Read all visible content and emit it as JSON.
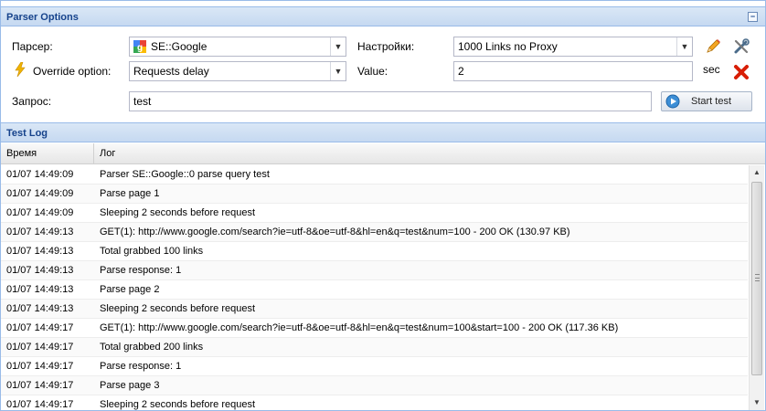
{
  "parser_options": {
    "title": "Parser Options",
    "parser_label": "Парсер:",
    "parser_value": "SE::Google",
    "settings_label": "Настройки:",
    "settings_value": "1000 Links no Proxy",
    "override_label": "Override option:",
    "override_value": "Requests delay",
    "value_label": "Value:",
    "value_value": "2",
    "value_unit": "sec",
    "query_label": "Запрос:",
    "query_value": "test",
    "start_test_label": "Start test",
    "icons": {
      "parser": "google-icon",
      "override": "lightning-icon",
      "edit": "pencil-icon",
      "tools": "tools-icon",
      "delete": "delete-x-icon",
      "start": "play-icon"
    }
  },
  "test_log": {
    "title": "Test Log",
    "columns": [
      "Время",
      "Лог"
    ],
    "rows": [
      {
        "time": "01/07 14:49:09",
        "log": "Parser SE::Google::0 parse query test"
      },
      {
        "time": "01/07 14:49:09",
        "log": "Parse page 1"
      },
      {
        "time": "01/07 14:49:09",
        "log": "Sleeping 2 seconds before request"
      },
      {
        "time": "01/07 14:49:13",
        "log": "GET(1): http://www.google.com/search?ie=utf-8&oe=utf-8&hl=en&q=test&num=100 - 200 OK (130.97 KB)"
      },
      {
        "time": "01/07 14:49:13",
        "log": "Total grabbed 100 links"
      },
      {
        "time": "01/07 14:49:13",
        "log": "Parse response: 1"
      },
      {
        "time": "01/07 14:49:13",
        "log": "Parse page 2"
      },
      {
        "time": "01/07 14:49:13",
        "log": "Sleeping 2 seconds before request"
      },
      {
        "time": "01/07 14:49:17",
        "log": "GET(1): http://www.google.com/search?ie=utf-8&oe=utf-8&hl=en&q=test&num=100&start=100 - 200 OK (117.36 KB)"
      },
      {
        "time": "01/07 14:49:17",
        "log": "Total grabbed 200 links"
      },
      {
        "time": "01/07 14:49:17",
        "log": "Parse response: 1"
      },
      {
        "time": "01/07 14:49:17",
        "log": "Parse page 3"
      },
      {
        "time": "01/07 14:49:17",
        "log": "Sleeping 2 seconds before request"
      }
    ]
  },
  "colors": {
    "header_text": "#15428b",
    "header_bg": "#c6d9f1",
    "border": "#99bbe8",
    "delete_red": "#d81e05",
    "pencil_orange": "#f5a623"
  }
}
